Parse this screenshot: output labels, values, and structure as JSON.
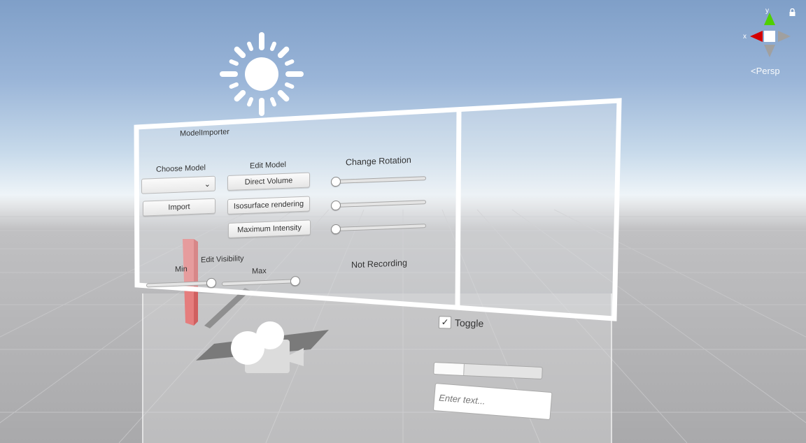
{
  "scene": {
    "view_mode": "Persp",
    "axis_labels": {
      "x": "x",
      "y": "y"
    },
    "colors": {
      "sky_top": "#7f9fc8",
      "ground": "#a9a9ab",
      "x_axis": "#d40000",
      "y_axis": "#4fd000"
    }
  },
  "panel": {
    "title": "ModelImporter",
    "choose_model": {
      "label": "Choose Model",
      "dropdown_value": "",
      "import_label": "Import"
    },
    "edit_model": {
      "label": "Edit Model",
      "buttons": [
        "Direct Volume",
        "Isosurface rendering",
        "Maximum Intensity"
      ]
    },
    "rotation": {
      "label": "Change Rotation",
      "sliders": [
        0.0,
        0.0,
        0.0
      ]
    },
    "visibility": {
      "label": "Edit Visibility",
      "min_label": "Min",
      "max_label": "Max",
      "min_value": 0.96,
      "max_value": 0.98
    },
    "status": "Not Recording"
  },
  "controls": {
    "toggle_label": "Toggle",
    "toggle_checked": true,
    "progress": 0.27,
    "text_placeholder": "Enter text..."
  }
}
